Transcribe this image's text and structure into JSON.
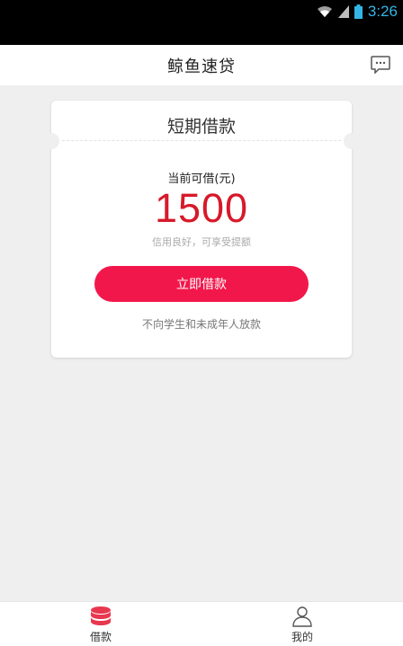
{
  "status_bar": {
    "time": "3:26"
  },
  "app_bar": {
    "title": "鲸鱼速贷",
    "message_icon": "message-icon"
  },
  "card": {
    "title": "短期借款",
    "limit_label": "当前可借(元)",
    "amount": "1500",
    "hint": "信用良好，可享受提额",
    "button_label": "立即借款",
    "disclaimer": "不向学生和未成年人放款"
  },
  "tabs": [
    {
      "label": "借款",
      "icon": "coins-icon",
      "active": true
    },
    {
      "label": "我的",
      "icon": "user-icon",
      "active": false
    }
  ],
  "colors": {
    "accent": "#f2174a",
    "amount": "#d7192a"
  }
}
